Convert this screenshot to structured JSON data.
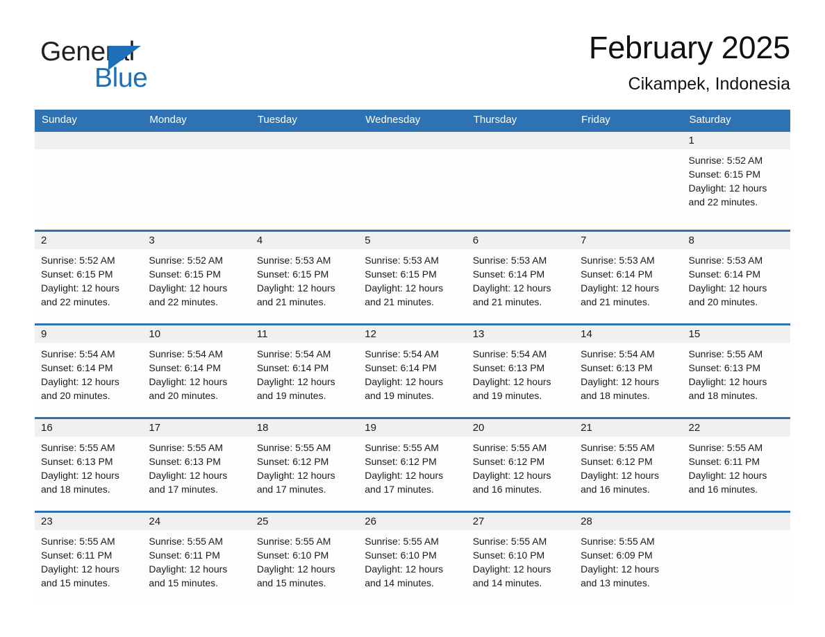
{
  "brand": {
    "name_part1": "General",
    "name_part2": "Blue",
    "accent_color": "#1d6fb8",
    "triangle_icon": "triangle-icon"
  },
  "header": {
    "title": "February 2025",
    "subtitle": "Cikampek, Indonesia"
  },
  "calendar": {
    "header_bg": "#2e72b4",
    "row_border_color": "#2e72b4",
    "day_strip_bg": "#f0f0f0",
    "weekdays": [
      "Sunday",
      "Monday",
      "Tuesday",
      "Wednesday",
      "Thursday",
      "Friday",
      "Saturday"
    ],
    "weeks": [
      [
        {
          "day": "",
          "empty": true,
          "lines": []
        },
        {
          "day": "",
          "empty": true,
          "lines": []
        },
        {
          "day": "",
          "empty": true,
          "lines": []
        },
        {
          "day": "",
          "empty": true,
          "lines": []
        },
        {
          "day": "",
          "empty": true,
          "lines": []
        },
        {
          "day": "",
          "empty": true,
          "lines": []
        },
        {
          "day": "1",
          "empty": false,
          "lines": [
            "Sunrise: 5:52 AM",
            "Sunset: 6:15 PM",
            "Daylight: 12 hours",
            "and 22 minutes."
          ]
        }
      ],
      [
        {
          "day": "2",
          "empty": false,
          "lines": [
            "Sunrise: 5:52 AM",
            "Sunset: 6:15 PM",
            "Daylight: 12 hours",
            "and 22 minutes."
          ]
        },
        {
          "day": "3",
          "empty": false,
          "lines": [
            "Sunrise: 5:52 AM",
            "Sunset: 6:15 PM",
            "Daylight: 12 hours",
            "and 22 minutes."
          ]
        },
        {
          "day": "4",
          "empty": false,
          "lines": [
            "Sunrise: 5:53 AM",
            "Sunset: 6:15 PM",
            "Daylight: 12 hours",
            "and 21 minutes."
          ]
        },
        {
          "day": "5",
          "empty": false,
          "lines": [
            "Sunrise: 5:53 AM",
            "Sunset: 6:15 PM",
            "Daylight: 12 hours",
            "and 21 minutes."
          ]
        },
        {
          "day": "6",
          "empty": false,
          "lines": [
            "Sunrise: 5:53 AM",
            "Sunset: 6:14 PM",
            "Daylight: 12 hours",
            "and 21 minutes."
          ]
        },
        {
          "day": "7",
          "empty": false,
          "lines": [
            "Sunrise: 5:53 AM",
            "Sunset: 6:14 PM",
            "Daylight: 12 hours",
            "and 21 minutes."
          ]
        },
        {
          "day": "8",
          "empty": false,
          "lines": [
            "Sunrise: 5:53 AM",
            "Sunset: 6:14 PM",
            "Daylight: 12 hours",
            "and 20 minutes."
          ]
        }
      ],
      [
        {
          "day": "9",
          "empty": false,
          "lines": [
            "Sunrise: 5:54 AM",
            "Sunset: 6:14 PM",
            "Daylight: 12 hours",
            "and 20 minutes."
          ]
        },
        {
          "day": "10",
          "empty": false,
          "lines": [
            "Sunrise: 5:54 AM",
            "Sunset: 6:14 PM",
            "Daylight: 12 hours",
            "and 20 minutes."
          ]
        },
        {
          "day": "11",
          "empty": false,
          "lines": [
            "Sunrise: 5:54 AM",
            "Sunset: 6:14 PM",
            "Daylight: 12 hours",
            "and 19 minutes."
          ]
        },
        {
          "day": "12",
          "empty": false,
          "lines": [
            "Sunrise: 5:54 AM",
            "Sunset: 6:14 PM",
            "Daylight: 12 hours",
            "and 19 minutes."
          ]
        },
        {
          "day": "13",
          "empty": false,
          "lines": [
            "Sunrise: 5:54 AM",
            "Sunset: 6:13 PM",
            "Daylight: 12 hours",
            "and 19 minutes."
          ]
        },
        {
          "day": "14",
          "empty": false,
          "lines": [
            "Sunrise: 5:54 AM",
            "Sunset: 6:13 PM",
            "Daylight: 12 hours",
            "and 18 minutes."
          ]
        },
        {
          "day": "15",
          "empty": false,
          "lines": [
            "Sunrise: 5:55 AM",
            "Sunset: 6:13 PM",
            "Daylight: 12 hours",
            "and 18 minutes."
          ]
        }
      ],
      [
        {
          "day": "16",
          "empty": false,
          "lines": [
            "Sunrise: 5:55 AM",
            "Sunset: 6:13 PM",
            "Daylight: 12 hours",
            "and 18 minutes."
          ]
        },
        {
          "day": "17",
          "empty": false,
          "lines": [
            "Sunrise: 5:55 AM",
            "Sunset: 6:13 PM",
            "Daylight: 12 hours",
            "and 17 minutes."
          ]
        },
        {
          "day": "18",
          "empty": false,
          "lines": [
            "Sunrise: 5:55 AM",
            "Sunset: 6:12 PM",
            "Daylight: 12 hours",
            "and 17 minutes."
          ]
        },
        {
          "day": "19",
          "empty": false,
          "lines": [
            "Sunrise: 5:55 AM",
            "Sunset: 6:12 PM",
            "Daylight: 12 hours",
            "and 17 minutes."
          ]
        },
        {
          "day": "20",
          "empty": false,
          "lines": [
            "Sunrise: 5:55 AM",
            "Sunset: 6:12 PM",
            "Daylight: 12 hours",
            "and 16 minutes."
          ]
        },
        {
          "day": "21",
          "empty": false,
          "lines": [
            "Sunrise: 5:55 AM",
            "Sunset: 6:12 PM",
            "Daylight: 12 hours",
            "and 16 minutes."
          ]
        },
        {
          "day": "22",
          "empty": false,
          "lines": [
            "Sunrise: 5:55 AM",
            "Sunset: 6:11 PM",
            "Daylight: 12 hours",
            "and 16 minutes."
          ]
        }
      ],
      [
        {
          "day": "23",
          "empty": false,
          "lines": [
            "Sunrise: 5:55 AM",
            "Sunset: 6:11 PM",
            "Daylight: 12 hours",
            "and 15 minutes."
          ]
        },
        {
          "day": "24",
          "empty": false,
          "lines": [
            "Sunrise: 5:55 AM",
            "Sunset: 6:11 PM",
            "Daylight: 12 hours",
            "and 15 minutes."
          ]
        },
        {
          "day": "25",
          "empty": false,
          "lines": [
            "Sunrise: 5:55 AM",
            "Sunset: 6:10 PM",
            "Daylight: 12 hours",
            "and 15 minutes."
          ]
        },
        {
          "day": "26",
          "empty": false,
          "lines": [
            "Sunrise: 5:55 AM",
            "Sunset: 6:10 PM",
            "Daylight: 12 hours",
            "and 14 minutes."
          ]
        },
        {
          "day": "27",
          "empty": false,
          "lines": [
            "Sunrise: 5:55 AM",
            "Sunset: 6:10 PM",
            "Daylight: 12 hours",
            "and 14 minutes."
          ]
        },
        {
          "day": "28",
          "empty": false,
          "lines": [
            "Sunrise: 5:55 AM",
            "Sunset: 6:09 PM",
            "Daylight: 12 hours",
            "and 13 minutes."
          ]
        },
        {
          "day": "",
          "empty": true,
          "lines": []
        }
      ]
    ]
  }
}
